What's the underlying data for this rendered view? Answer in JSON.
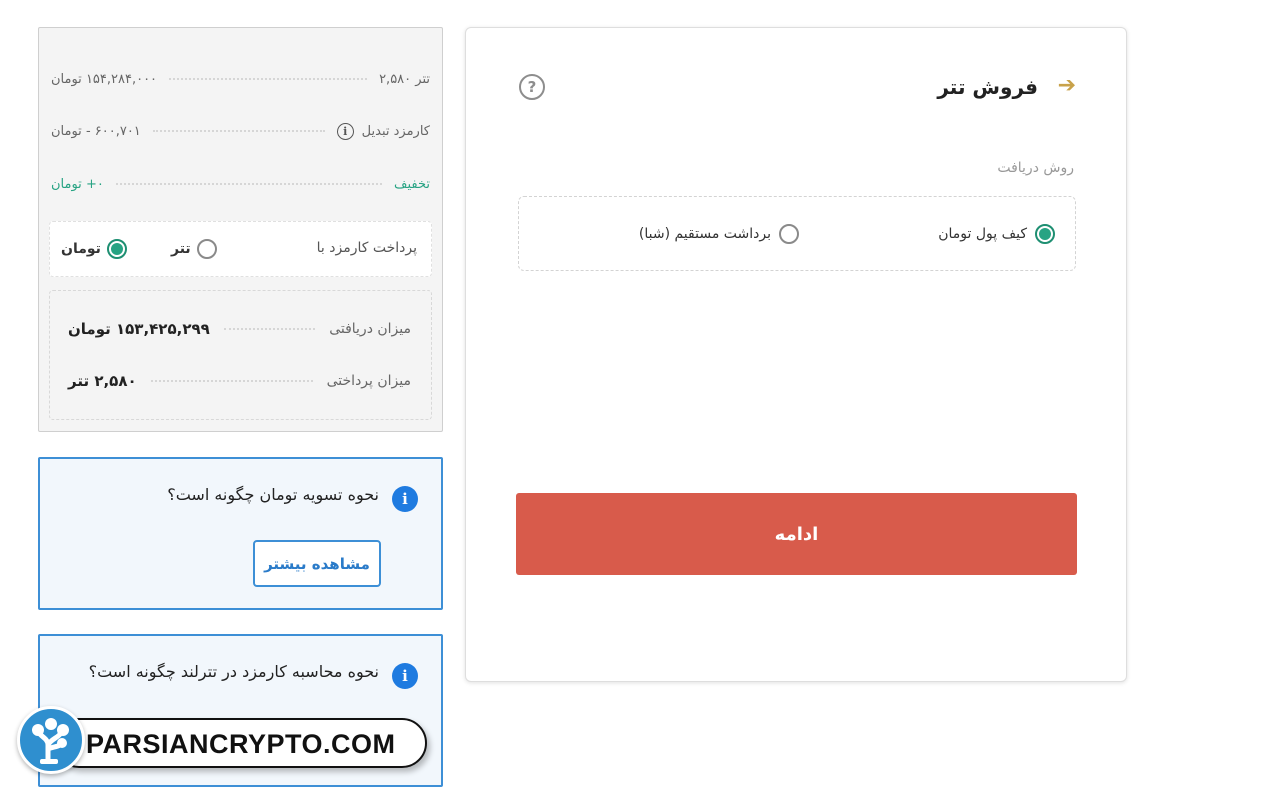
{
  "summary": {
    "rows": [
      {
        "label": "۲,۵۸۰ تتر",
        "value": "۱۵۴,۲۸۴,۰۰۰ تومان"
      },
      {
        "label": "کارمزد تبدیل",
        "value": "۶۰۰,۷۰۱ - تومان"
      },
      {
        "label": "تخفیف",
        "value": "۰+ تومان"
      }
    ],
    "fee": {
      "label": "پرداخت کارمزد با",
      "option_usdt": "تتر",
      "option_toman": "تومان",
      "selected": "toman"
    },
    "result": {
      "received_label": "میزان دریافتی",
      "received_value": "۱۵۳,۴۲۵,۲۹۹ تومان",
      "paid_label": "میزان پرداختی",
      "paid_value": "۲,۵۸۰ تتر"
    }
  },
  "help_boxes": [
    {
      "question": "نحوه تسویه تومان چگونه است؟",
      "button": "مشاهده بیشتر",
      "icon": "info-icon"
    },
    {
      "question": "نحوه محاسبه کارمزد در تترلند چگونه است؟",
      "icon": "info-icon"
    }
  ],
  "sell_card": {
    "title": "فروش تتر",
    "back_icon": "arrow-right-icon",
    "help_icon": "question-icon",
    "method_label": "روش دریافت",
    "methods": [
      {
        "label": "کیف پول تومان",
        "selected": true
      },
      {
        "label": "برداشت مستقیم (شبا)",
        "selected": false
      }
    ],
    "continue_label": "ادامه"
  },
  "watermark": {
    "text": "PARSIANCRYPTO.COM"
  },
  "colors": {
    "accent_green": "#27a383",
    "info_blue": "#1f7be0",
    "continue_red": "#d85b4b",
    "back_gold": "#c8a24a"
  }
}
